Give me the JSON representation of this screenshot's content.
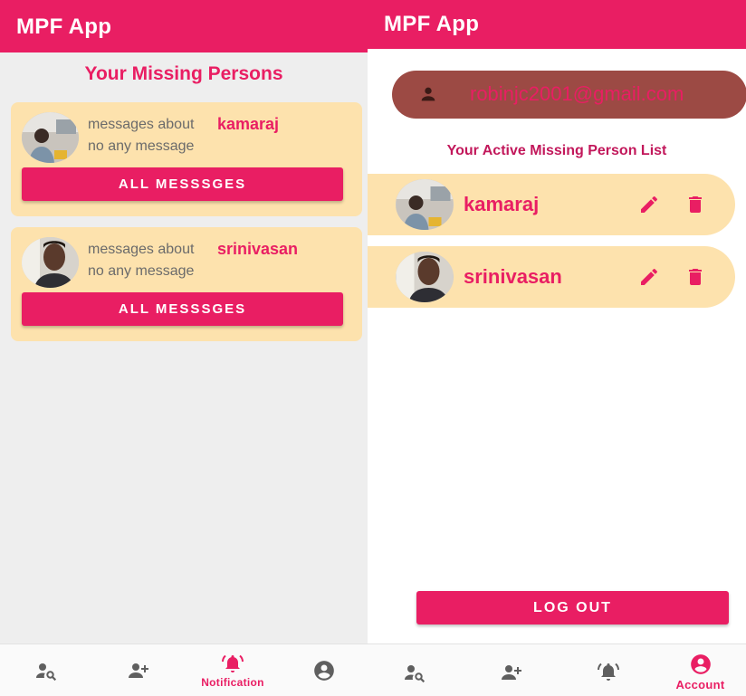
{
  "app": {
    "title": "MPF App"
  },
  "notifications_screen": {
    "title": "Your Missing Persons",
    "cards": [
      {
        "prefix": "messages about",
        "name": "kamaraj",
        "status": "no any message",
        "button": "ALL MESSSGES"
      },
      {
        "prefix": "messages about",
        "name": "srinivasan",
        "status": "no any message",
        "button": "ALL MESSSGES"
      }
    ],
    "nav": {
      "active_label": "Notification"
    }
  },
  "account_screen": {
    "email": "robinjc2001@gmail.com",
    "list_title": "Your Active Missing Person List",
    "persons": [
      {
        "name": "kamaraj"
      },
      {
        "name": "srinivasan"
      }
    ],
    "logout_label": "LOG OUT",
    "nav": {
      "active_label": "Account"
    }
  },
  "colors": {
    "primary": "#e91e63",
    "card": "#fde2ad",
    "email_pill": "#9c4a44",
    "nav_icon": "#5f5f5f"
  },
  "icons": [
    "search-person-icon",
    "add-person-icon",
    "notification-bell-icon",
    "account-circle-icon",
    "person-icon",
    "edit-pencil-icon",
    "delete-trash-icon"
  ]
}
